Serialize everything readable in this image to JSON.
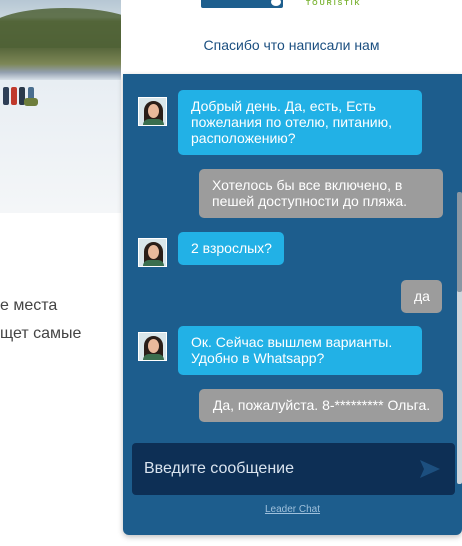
{
  "background": {
    "line1": "е места",
    "line2": "щет самые"
  },
  "widget": {
    "logo_text": "TOURISTIK",
    "header_title": "Спасибо что написали нам",
    "accent_color": "#22b1e6",
    "panel_color": "#1d5d8d"
  },
  "messages": [
    {
      "from": "operator",
      "text": "Добрый день. Да, есть, Есть пожелания по отелю,  питанию, расположению?"
    },
    {
      "from": "user",
      "text": "Хотелось бы все включено, в пешей доступности до пляжа."
    },
    {
      "from": "operator",
      "text": "2 взрослых?"
    },
    {
      "from": "user",
      "text": "да"
    },
    {
      "from": "operator",
      "text": "Ок. Сейчас вышлем варианты. Удобно  в Whatsapp?"
    },
    {
      "from": "user",
      "text": "Да, пожалуйста. 8-********* Ольга."
    }
  ],
  "composer": {
    "placeholder": "Введите сообщение",
    "send_icon": "send-arrow-icon"
  },
  "footer": {
    "link": "Leader Chat"
  }
}
